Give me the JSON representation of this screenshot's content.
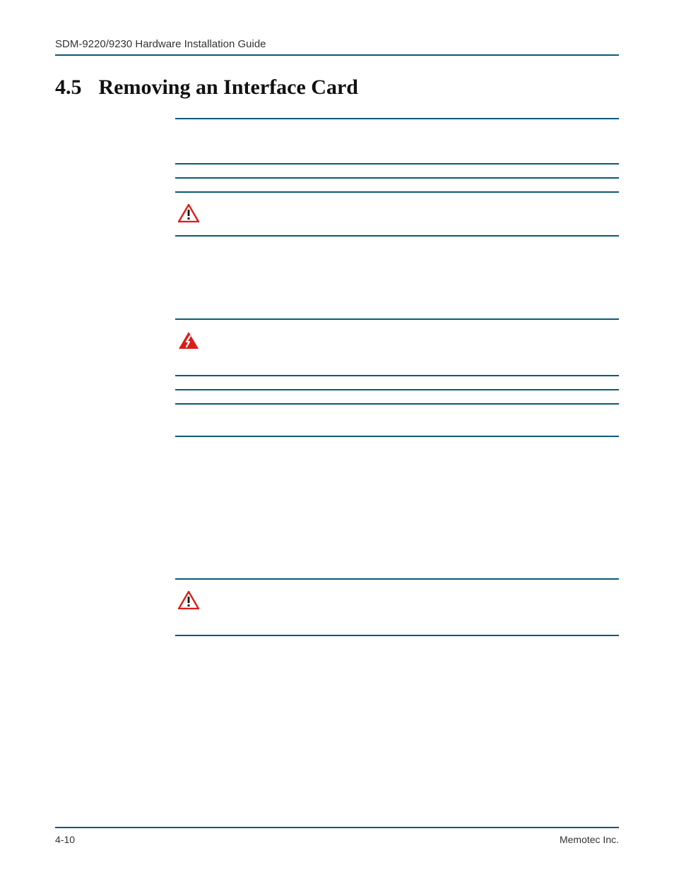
{
  "header": {
    "running_title": "SDM-9220/9230 Hardware Installation Guide"
  },
  "heading": {
    "number": "4.5",
    "title": "Removing an Interface Card"
  },
  "icons": {
    "caution1": "caution-triangle",
    "warning": "electrical-warning-triangle",
    "caution2": "caution-triangle"
  },
  "footer": {
    "page_number": "4-10",
    "company": "Memotec Inc."
  }
}
